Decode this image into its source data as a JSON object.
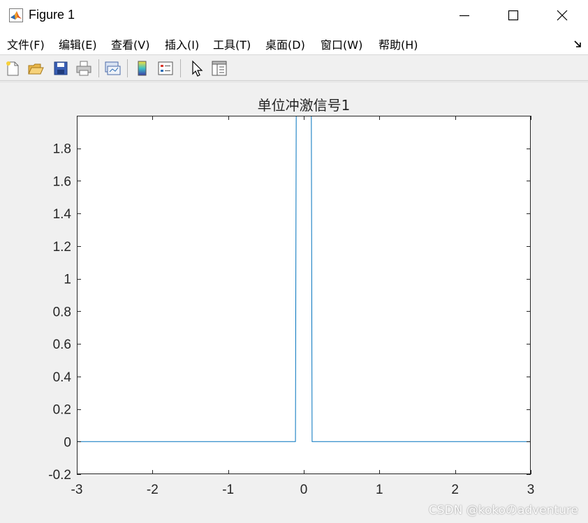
{
  "window": {
    "title": "Figure 1",
    "icon": "matlab-icon"
  },
  "controls": {
    "minimize_icon": "minimize-icon",
    "maximize_icon": "maximize-icon",
    "close_icon": "close-icon"
  },
  "menu": {
    "items": [
      {
        "label": "文件(F)"
      },
      {
        "label": "编辑(E)"
      },
      {
        "label": "查看(V)"
      },
      {
        "label": "插入(I)"
      },
      {
        "label": "工具(T)"
      },
      {
        "label": "桌面(D)"
      },
      {
        "label": "窗口(W)"
      },
      {
        "label": "帮助(H)"
      }
    ],
    "dock_icon": "dock-arrow-icon"
  },
  "toolbar": {
    "icons": [
      "new-figure-icon",
      "open-file-icon",
      "save-icon",
      "print-icon",
      "link-plot-icon",
      "colorbar-icon",
      "legend-icon",
      "edit-plot-cursor-icon",
      "property-inspector-icon"
    ]
  },
  "chart_data": {
    "type": "line",
    "title": "单位冲激信号1",
    "xlabel": "",
    "ylabel": "",
    "xlim": [
      -3,
      3
    ],
    "ylim": [
      -0.2,
      2
    ],
    "xticks": [
      "-3",
      "-2",
      "-1",
      "0",
      "1",
      "2",
      "3"
    ],
    "yticks": [
      "-0.2",
      "0",
      "0.2",
      "0.4",
      "0.6",
      "0.8",
      "1",
      "1.2",
      "1.4",
      "1.6",
      "1.8"
    ],
    "grid": false,
    "legend": "none",
    "line_color": "#0072bd",
    "series": [
      {
        "x": [
          -3,
          -0.11,
          -0.1,
          0.1,
          0.11,
          3
        ],
        "y": [
          0,
          0,
          2,
          2,
          0,
          0
        ]
      }
    ]
  },
  "watermark": "CSDN @kokoのadventure"
}
